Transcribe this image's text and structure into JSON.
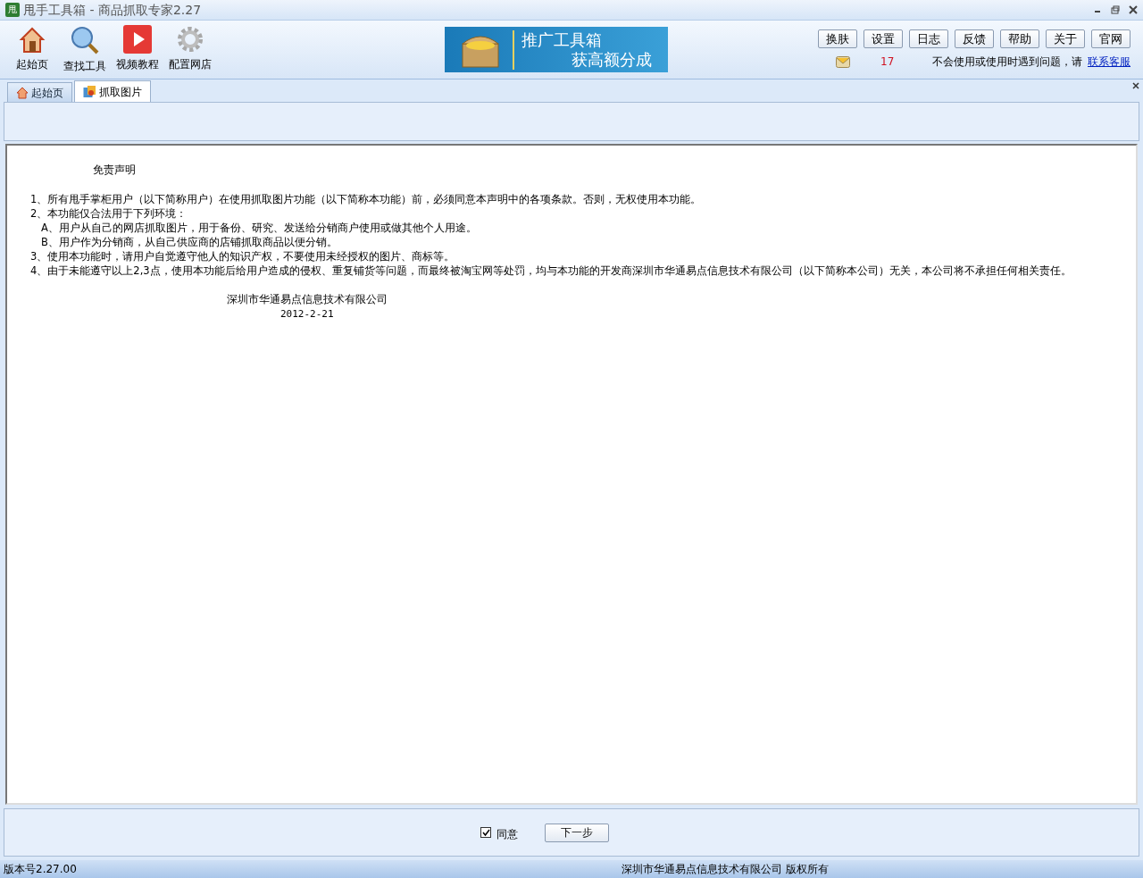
{
  "window": {
    "logo": "甩",
    "title": "甩手工具箱 - 商品抓取专家2.27"
  },
  "toolbar": {
    "tools": [
      {
        "kind": "home",
        "label": "起始页"
      },
      {
        "kind": "search",
        "label": "查找工具"
      },
      {
        "kind": "video",
        "label": "视频教程"
      },
      {
        "kind": "settings",
        "label": "配置网店"
      }
    ]
  },
  "banner": {
    "line_1": "推广工具箱",
    "line_2": "获高额分成"
  },
  "top_buttons": [
    "换肤",
    "设置",
    "日志",
    "反馈",
    "帮助",
    "关于",
    "官网"
  ],
  "notice": {
    "count": "17",
    "message": "不会使用或使用时遇到问题，请",
    "link": "联系客服"
  },
  "tabs": [
    {
      "kind": "home",
      "label": "起始页",
      "selected": false
    },
    {
      "kind": "picture",
      "label": "抓取图片",
      "selected": true
    }
  ],
  "disclaimer": {
    "title": "免责声明",
    "items": [
      {
        "text": "1、所有甩手掌柜用户（以下简称用户）在使用抓取图片功能（以下简称本功能）前，必须同意本声明中的各项条款。否则，无权使用本功能。"
      },
      {
        "text": "2、本功能仅合法用于下列环境：",
        "children": [
          {
            "text": "A、用户从自己的网店抓取图片，用于备份、研究、发送给分销商户使用或做其他个人用途。"
          },
          {
            "text": "B、用户作为分销商，从自己供应商的店铺抓取商品以便分销。"
          }
        ]
      },
      {
        "text": "3、使用本功能时，请用户自觉遵守他人的知识产权，不要使用未经授权的图片、商标等。"
      },
      {
        "text": "4、由于未能遵守以上2,3点，使用本功能后给用户造成的侵权、重复铺货等问题，而最终被淘宝网等处罚，均与本功能的开发商深圳市华通易点信息技术有限公司（以下简称本公司）无关，本公司将不承担任何相关责任。"
      }
    ],
    "company": "深圳市华通易点信息技术有限公司",
    "date": "2012-2-21"
  },
  "agree": {
    "label": "同意",
    "checked": true
  },
  "next_button": "下一步",
  "status_bar": {
    "version": "版本号2.27.00",
    "copyright": "深圳市华通易点信息技术有限公司 版权所有"
  }
}
